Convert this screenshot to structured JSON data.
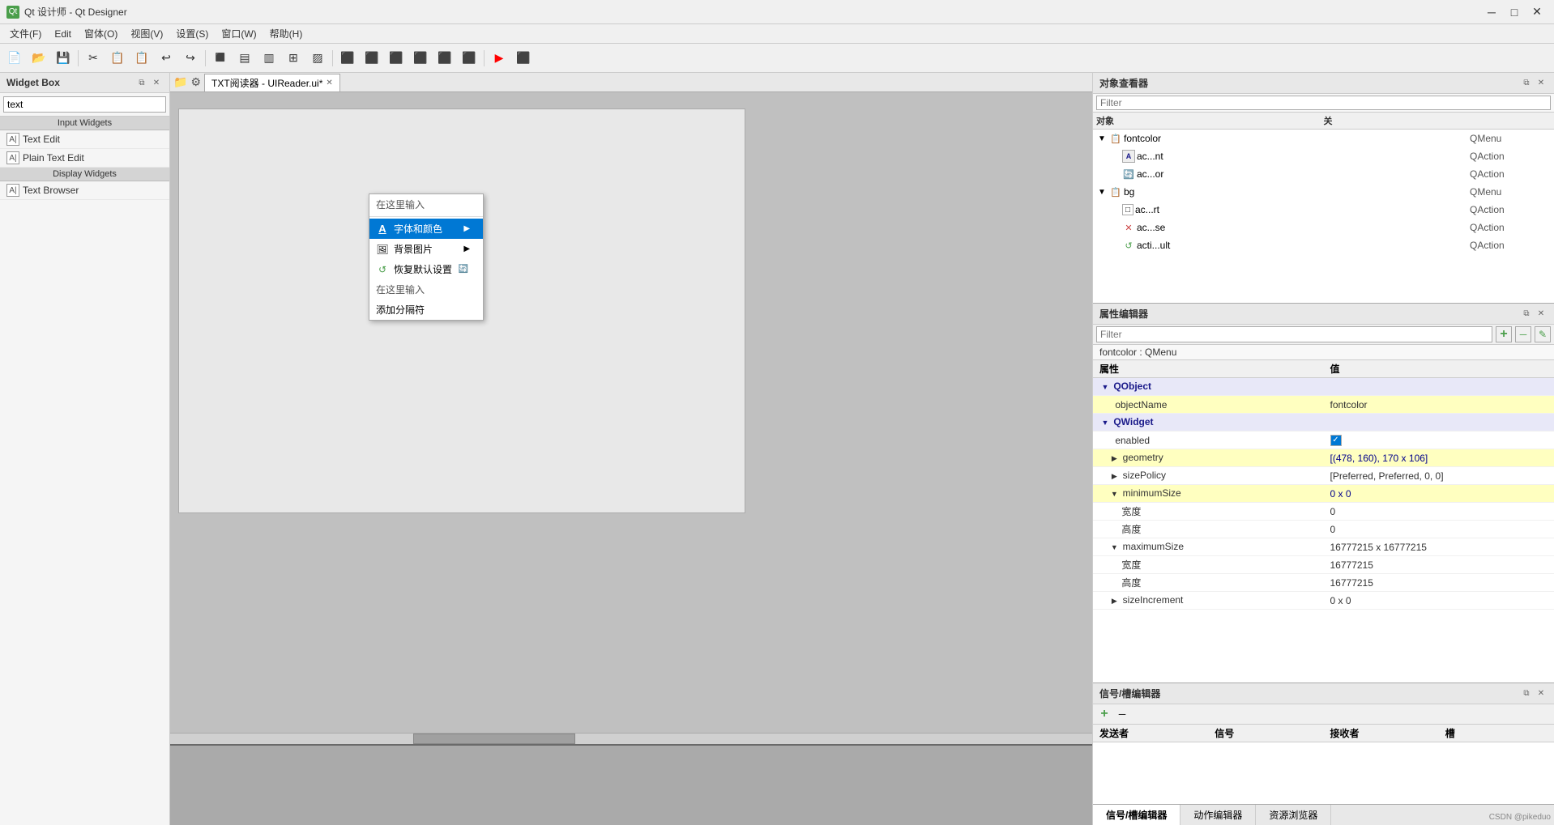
{
  "titleBar": {
    "icon": "Qt",
    "title": "Qt 设计师 - Qt Designer",
    "minimizeLabel": "─",
    "maximizeLabel": "□",
    "closeLabel": "✕"
  },
  "menuBar": {
    "items": [
      {
        "label": "文件(F)"
      },
      {
        "label": "Edit"
      },
      {
        "label": "窗体(O)"
      },
      {
        "label": "视图(V)"
      },
      {
        "label": "设置(S)"
      },
      {
        "label": "窗口(W)"
      },
      {
        "label": "帮助(H)"
      }
    ]
  },
  "toolbar": {
    "buttons": [
      "📄",
      "📂",
      "💾",
      "",
      "✂",
      "📋",
      "📋",
      "↩",
      "↪",
      "",
      "🔲",
      "🔲",
      "🔲",
      "🔲",
      "",
      "▤",
      "▤",
      "▤",
      "▤",
      "▤",
      "▤",
      "",
      "🔴",
      "🔲"
    ]
  },
  "widgetBox": {
    "title": "Widget Box",
    "searchPlaceholder": "text",
    "categories": [
      {
        "name": "Input Widgets",
        "items": [
          {
            "label": "Text Edit",
            "icon": "A|"
          },
          {
            "label": "Plain Text Edit",
            "icon": "A|"
          },
          {
            "label": "Text Browser",
            "icon": "A|"
          }
        ]
      },
      {
        "name": "Display Widgets",
        "items": []
      }
    ]
  },
  "centerTab": {
    "label": "TXT阅读器 - UIReader.ui*",
    "toolbarIcons": [
      "📁",
      "⚙"
    ]
  },
  "contextMenu": {
    "headerLabel": "在这里输入",
    "items": [
      {
        "label": "字体和颜色",
        "icon": "A",
        "hasSubmenu": true,
        "highlighted": true
      },
      {
        "label": "背景图片",
        "icon": "🖼",
        "hasSubmenu": true
      },
      {
        "label": "恢复默认设置",
        "icon": "↺",
        "extraIcon": "🔄"
      },
      {
        "label": "在这里输入",
        "isInput": true
      },
      {
        "label": "添加分隔符"
      }
    ]
  },
  "objectInspector": {
    "title": "对象查看器",
    "filterPlaceholder": "Filter",
    "colHeaders": [
      "对象",
      "关"
    ],
    "rows": [
      {
        "indent": 0,
        "expand": "▼",
        "icon": "📋",
        "name": "fontcolor",
        "type": "QMenu",
        "isExpandable": true
      },
      {
        "indent": 1,
        "expand": "",
        "icon": "⚡",
        "name": "ac...nt",
        "type": "QAction",
        "typeIcon": "A"
      },
      {
        "indent": 1,
        "expand": "",
        "icon": "⚡",
        "name": "ac...or",
        "type": "QAction",
        "typeIcon": "🔄"
      },
      {
        "indent": 0,
        "expand": "▼",
        "icon": "📋",
        "name": "bg",
        "type": "QMenu",
        "isExpandable": true
      },
      {
        "indent": 1,
        "expand": "",
        "icon": "⚡",
        "name": "ac...rt",
        "type": "QAction",
        "typeIcon": "□"
      },
      {
        "indent": 1,
        "expand": "",
        "icon": "⚡",
        "name": "ac...se",
        "type": "QAction",
        "typeIcon": "✕"
      },
      {
        "indent": 1,
        "expand": "",
        "icon": "⚡",
        "name": "acti...ult",
        "type": "QAction",
        "typeIcon": "↺"
      }
    ]
  },
  "propertyEditor": {
    "title": "属性编辑器",
    "filterPlaceholder": "Filter",
    "contextLabel": "fontcolor : QMenu",
    "colHeaders": [
      "属性",
      "值"
    ],
    "sections": [
      {
        "category": "QObject",
        "rows": [
          {
            "name": "objectName",
            "value": "fontcolor",
            "indent": 1,
            "isYellow": true
          }
        ]
      },
      {
        "category": "QWidget",
        "rows": [
          {
            "name": "enabled",
            "value": "☑",
            "indent": 1,
            "isCheckbox": true,
            "checked": true
          },
          {
            "name": "geometry",
            "value": "[(478, 160), 170 x 106]",
            "indent": 1,
            "isYellow": true,
            "hasExpand": true
          },
          {
            "name": "sizePolicy",
            "value": "[Preferred, Preferred, 0, 0]",
            "indent": 1,
            "hasExpand": true
          },
          {
            "name": "minimumSize",
            "value": "0 x 0",
            "indent": 1,
            "hasExpand": true,
            "isYellow": true
          },
          {
            "name": "宽度",
            "value": "0",
            "indent": 2
          },
          {
            "name": "高度",
            "value": "0",
            "indent": 2
          },
          {
            "name": "maximumSize",
            "value": "16777215 x 16777215",
            "indent": 1,
            "hasExpand": true
          },
          {
            "name": "宽度",
            "value": "16777215",
            "indent": 2
          },
          {
            "name": "高度",
            "value": "16777215",
            "indent": 2
          },
          {
            "name": "sizeIncrement",
            "value": "0 x 0",
            "indent": 1,
            "hasExpand": true
          }
        ]
      }
    ]
  },
  "signalEditor": {
    "title": "信号/槽编辑器",
    "addIcon": "+",
    "removeIcon": "─",
    "colHeaders": [
      "发送者",
      "信号",
      "接收者",
      "槽"
    ],
    "rows": []
  },
  "bottomTabs": [
    {
      "label": "信号/槽编辑器",
      "active": true
    },
    {
      "label": "动作编辑器"
    },
    {
      "label": "资源浏览器"
    }
  ],
  "bottomRightLabel": "CSDN @pikeduo"
}
